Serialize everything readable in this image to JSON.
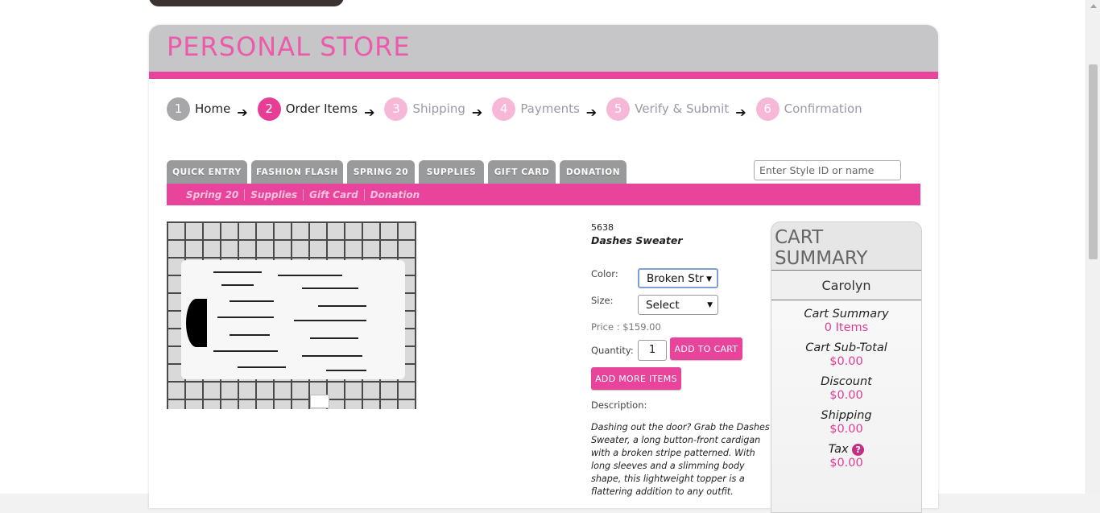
{
  "store": {
    "title": "PERSONAL STORE"
  },
  "steps": [
    {
      "num": "1",
      "label": "Home",
      "state": "done"
    },
    {
      "num": "2",
      "label": "Order Items",
      "state": "active"
    },
    {
      "num": "3",
      "label": "Shipping",
      "state": "todo"
    },
    {
      "num": "4",
      "label": "Payments",
      "state": "todo"
    },
    {
      "num": "5",
      "label": "Verify & Submit",
      "state": "todo"
    },
    {
      "num": "6",
      "label": "Confirmation",
      "state": "todo"
    }
  ],
  "tabs": [
    "QUICK ENTRY",
    "FASHION FLASH",
    "SPRING 20",
    "SUPPLIES",
    "GIFT CARD",
    "DONATION"
  ],
  "search": {
    "placeholder": "Enter Style ID or name"
  },
  "subnav": [
    "Spring 20",
    "Supplies",
    "Gift Card",
    "Donation"
  ],
  "product": {
    "style_id": "5638",
    "name": "Dashes Sweater",
    "color_label": "Color:",
    "color_value": "Broken Str",
    "size_label": "Size:",
    "size_value": "Select",
    "price": "Price : $159.00",
    "quantity_label": "Quantity:",
    "quantity_value": "1",
    "add_to_cart": "ADD TO CART",
    "add_more": "ADD MORE ITEMS",
    "description_label": "Description:",
    "description": "Dashing out the door? Grab the Dashes Sweater, a long button-front cardigan with a broken stripe patterned. With long sleeves and a slimming body shape, this lightweight topper is a flattering addition to any outfit."
  },
  "cart": {
    "title": "CART SUMMARY",
    "user": "Carolyn",
    "summary_label": "Cart Summary",
    "items": "0 Items",
    "subtotal_label": "Cart Sub-Total",
    "subtotal": "$0.00",
    "discount_label": "Discount",
    "discount": "$0.00",
    "shipping_label": "Shipping",
    "shipping": "$0.00",
    "tax_label": "Tax",
    "tax_help": "?",
    "tax": "$0.00"
  },
  "colors": {
    "accent": "#e8449c",
    "header_grey": "#c6c6c8",
    "tab_grey": "#999a9c"
  }
}
